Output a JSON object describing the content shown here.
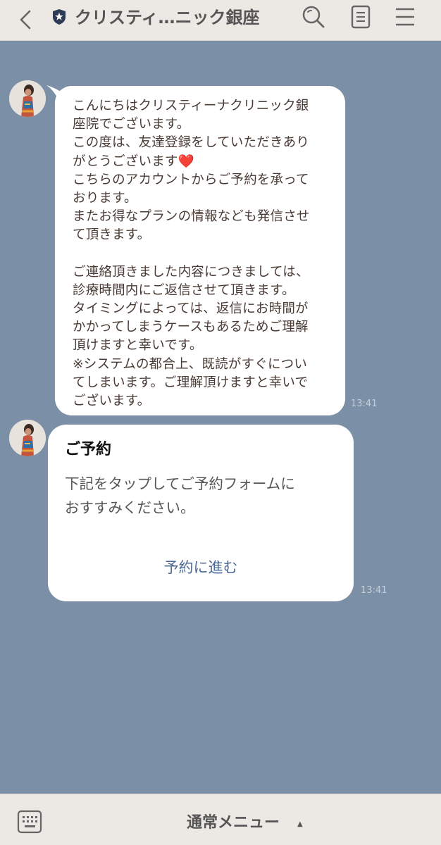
{
  "header": {
    "title": "クリスティ…ニック銀座",
    "back_icon": "chevron-left-icon",
    "badge_icon": "shield-star-icon",
    "search_icon": "search-icon",
    "notes_icon": "notes-icon",
    "menu_icon": "hamburger-menu-icon"
  },
  "messages": [
    {
      "lines": [
        "こんにちはクリスティーナクリニック銀",
        "座院でございます。",
        "この度は、友達登録をしていただきあり",
        "がとうございます❤️",
        "こちらのアカウントからご予約を承って",
        "おります。",
        "またお得なプランの情報なども発信させ",
        "て頂きます。",
        "",
        "ご連絡頂きました内容につきましては、",
        "診療時間内にご返信させて頂きます。",
        "タイミングによっては、返信にお時間が",
        "かかってしまうケースもあるためご理解",
        "頂けますと幸いです。",
        "※システムの都合上、既読がすぐについ",
        "てしまいます。ご理解頂けますと幸いで",
        "ございます。"
      ],
      "time": "13:41"
    }
  ],
  "card": {
    "title": "ご予約",
    "body_lines": [
      "下記をタップしてご予約フォームに",
      "おすすみください。"
    ],
    "link_label": "予約に進む",
    "time": "13:41"
  },
  "bottom_bar": {
    "keyboard_icon": "keyboard-icon",
    "menu_label": "通常メニュー",
    "menu_arrow": "▲"
  },
  "colors": {
    "chat_background": "#7b90a7",
    "header_background": "#ece8e4",
    "bubble_text": "#4a3b35",
    "link": "#4b6a96",
    "time": "#c6d0da"
  }
}
